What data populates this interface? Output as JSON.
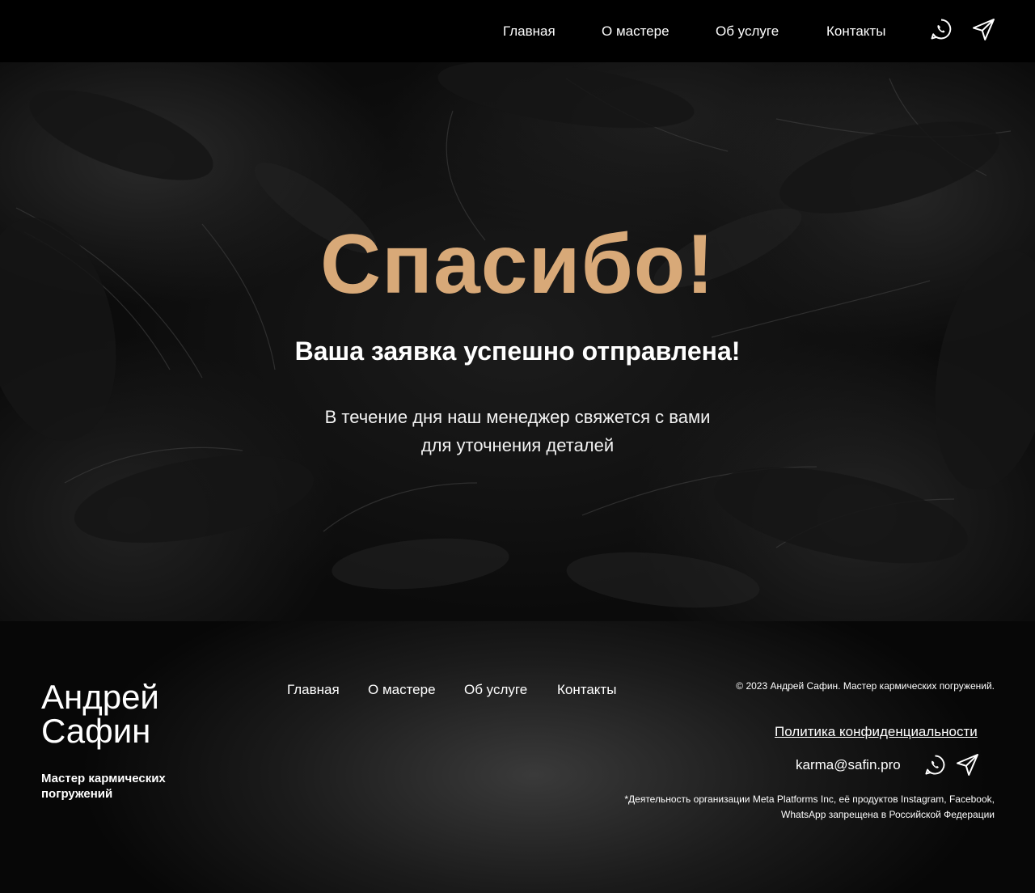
{
  "header": {
    "nav": [
      {
        "label": "Главная"
      },
      {
        "label": "О мастере"
      },
      {
        "label": "Об услуге"
      },
      {
        "label": "Контакты"
      }
    ],
    "icons": [
      "whatsapp-icon",
      "telegram-icon"
    ]
  },
  "hero": {
    "title": "Спасибо!",
    "subtitle": "Ваша заявка успешно отправлена!",
    "text_line1": "В течение дня наш менеджер свяжется с вами",
    "text_line2": "для уточнения деталей"
  },
  "footer": {
    "name_line1": "Андрей",
    "name_line2": "Сафин",
    "tagline_line1": "Мастер кармических",
    "tagline_line2": "погружений",
    "nav": [
      {
        "label": "Главная"
      },
      {
        "label": "О мастере"
      },
      {
        "label": "Об услуге"
      },
      {
        "label": "Контакты"
      }
    ],
    "copyright": "© 2023 Андрей Сафин. Мастер кармических погружений.",
    "privacy": "Политика конфиденциальности",
    "email": "karma@safin.pro",
    "disclaimer_line1": "*Деятельность организации Meta Platforms Inc, её продуктов Instagram, Facebook,",
    "disclaimer_line2": "WhatsApp запрещена в Российской Федерации"
  },
  "colors": {
    "accent": "#d8a978",
    "background": "#000000",
    "text": "#ffffff"
  }
}
